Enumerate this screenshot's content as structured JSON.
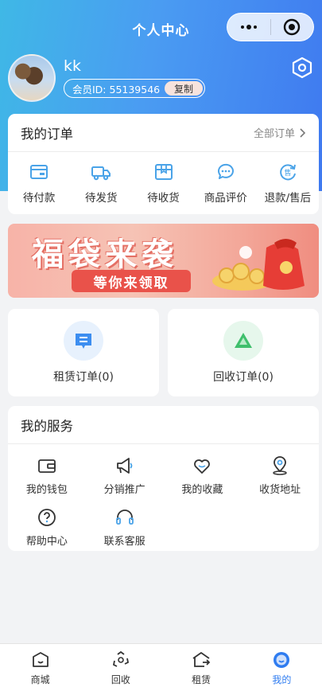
{
  "header": {
    "title": "个人中心",
    "username": "kk",
    "member_id": "会员ID: 55139546",
    "copy_label": "复制"
  },
  "orders": {
    "title": "我的订单",
    "all_label": "全部订单",
    "items": [
      {
        "label": "待付款",
        "icon": "wallet-card-icon"
      },
      {
        "label": "待发货",
        "icon": "truck-icon"
      },
      {
        "label": "待收货",
        "icon": "package-box-icon"
      },
      {
        "label": "商品评价",
        "icon": "chat-bubble-icon"
      },
      {
        "label": "退款/售后",
        "icon": "refund-icon"
      }
    ]
  },
  "banner": {
    "headline": "福袋来袭",
    "sub": "等你来领取"
  },
  "quick": {
    "rental": {
      "label": "租赁订单(0)",
      "icon": "document-list-icon"
    },
    "recycle": {
      "label": "回收订单(0)",
      "icon": "recycle-triangle-icon"
    }
  },
  "services": {
    "title": "我的服务",
    "items": [
      {
        "label": "我的钱包",
        "icon": "wallet-icon"
      },
      {
        "label": "分销推广",
        "icon": "megaphone-icon"
      },
      {
        "label": "我的收藏",
        "icon": "heart-icon"
      },
      {
        "label": "收货地址",
        "icon": "location-pin-icon"
      },
      {
        "label": "帮助中心",
        "icon": "question-circle-icon"
      },
      {
        "label": "联系客服",
        "icon": "headset-icon"
      }
    ]
  },
  "tabbar": {
    "items": [
      {
        "label": "商城",
        "icon": "shop-icon"
      },
      {
        "label": "回收",
        "icon": "recycle-icon"
      },
      {
        "label": "租赁",
        "icon": "rental-house-icon"
      },
      {
        "label": "我的",
        "icon": "profile-icon"
      }
    ],
    "active": "我的"
  },
  "colors": {
    "accent": "#2f7cf0",
    "header_from": "#3fb8e6",
    "header_to": "#3f79f0",
    "banner_red": "#e9524a"
  }
}
